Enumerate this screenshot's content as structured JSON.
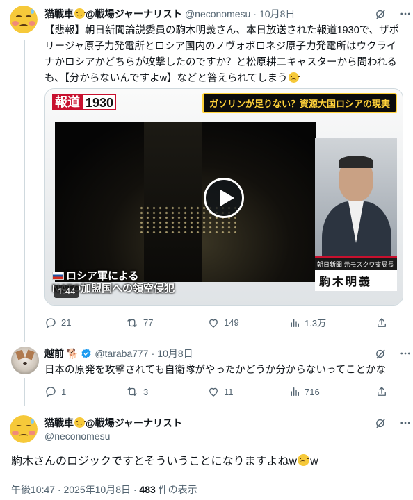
{
  "post1": {
    "display_name": "猫戦車",
    "display_name_suffix": "@戦場ジャーナリスト",
    "handle": "@neconomesu",
    "date": "10月8日",
    "text_a": "【悲報】朝日新聞論説委員の駒木明義さん、本日放送された報道1930で、ザポリージャ原子力発電所とロシア国内のノヴォボロネジ原子力発電所はウクライナかロシアかどちらが攻撃したのですか？と松原耕二キャスターから問われるも、【分からないんですよw】などと答えられてしまう",
    "media": {
      "logo_red": "報道",
      "logo_num": "1930",
      "banner": "ガソリンが足りない？資源大国ロシアの現実",
      "caption_line1": "ロシア軍による",
      "caption_line2": "NATO加盟国への領空侵犯",
      "nameplate_affiliation": "朝日新聞 元モスクワ支局長",
      "nameplate_name": "駒木明義",
      "duration": "1:44"
    },
    "stats": {
      "replies": "21",
      "reposts": "77",
      "likes": "149",
      "views": "1.3万"
    }
  },
  "post2": {
    "display_name": "越前",
    "handle": "@taraba777",
    "date": "10月8日",
    "text": "日本の原発を攻撃されても自衛隊がやったかどうか分からないってことかな",
    "stats": {
      "replies": "1",
      "reposts": "3",
      "likes": "11",
      "views": "716"
    }
  },
  "post3": {
    "display_name": "猫戦車",
    "display_name_suffix": "@戦場ジャーナリスト",
    "handle": "@neconomesu",
    "text_a": "駒木さんのロジックですとそういうことになりますよねw",
    "text_b": "w",
    "time": "午後10:47 · 2025年10月8日 · ",
    "view_count": "483",
    "view_suffix": " 件の表示"
  },
  "colors": {
    "text": "#0f1419",
    "muted": "#536471",
    "border": "#cfd9de",
    "verified": "#1d9bf0"
  },
  "icons": [
    "reply-icon",
    "repost-icon",
    "like-icon",
    "views-icon",
    "share-icon",
    "grok-icon",
    "more-icon",
    "verified-icon",
    "dog-emoji-icon",
    "sweat-smile-emoji-icon"
  ]
}
